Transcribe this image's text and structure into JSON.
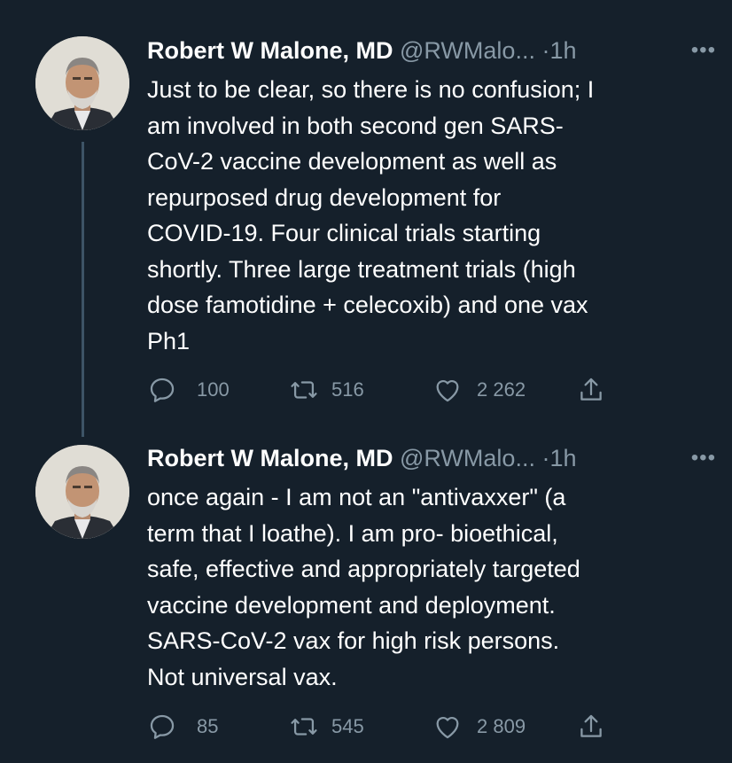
{
  "tweets": [
    {
      "author": {
        "name": "Robert W Malone, MD",
        "handle": "@RWMalo...",
        "separator": "·",
        "time": "1h"
      },
      "text": "Just to be clear, so there is no confusion; I\nam involved in both second gen SARS-\nCoV-2 vaccine development as well as\nrepurposed drug development for\nCOVID-19. Four clinical trials starting\nshortly.  Three large treatment trials (high\ndose famotidine + celecoxib) and one vax\nPh1",
      "actions": {
        "replies": "100",
        "retweets": "516",
        "likes": "2 262"
      }
    },
    {
      "author": {
        "name": "Robert W Malone, MD",
        "handle": "@RWMalo...",
        "separator": "·",
        "time": "1h"
      },
      "text": "once again - I am not an \"antivaxxer\" (a\nterm that I loathe).  I am pro- bioethical,\nsafe, effective and appropriately targeted\nvaccine development and deployment.\nSARS-CoV-2 vax for high risk persons.\nNot universal vax.",
      "actions": {
        "replies": "85",
        "retweets": "545",
        "likes": "2 809"
      }
    }
  ],
  "more_icon": "more-horizontal-icon",
  "icons": [
    "reply-icon",
    "retweet-icon",
    "like-icon",
    "share-icon"
  ],
  "colors": {
    "background": "#15202b",
    "text": "#ffffff",
    "secondary": "#8899a6",
    "thread_line": "#3d5466"
  }
}
